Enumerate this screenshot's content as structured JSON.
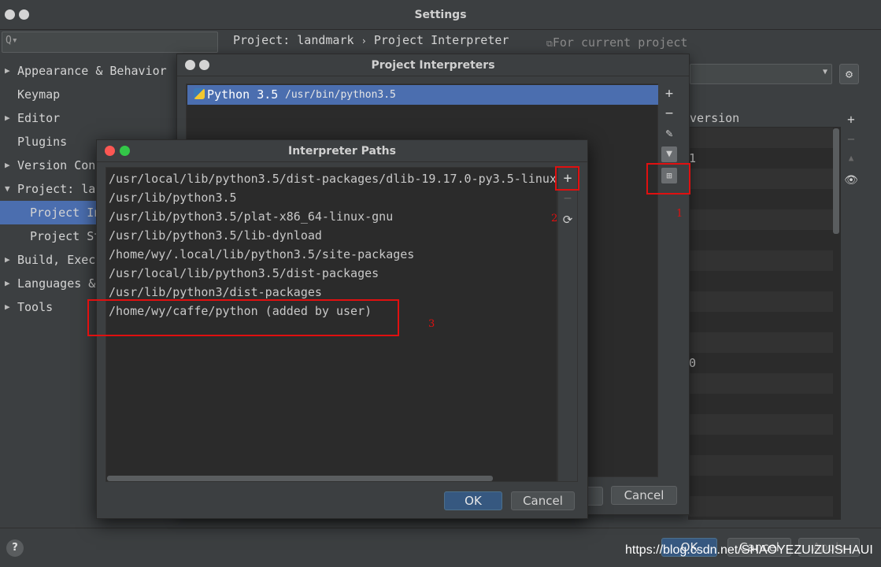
{
  "settings": {
    "title": "Settings",
    "search_placeholder": "Q▾",
    "breadcrumb": {
      "project": "Project: landmark",
      "separator": "›",
      "page": "Project Interpreter"
    },
    "for_current_project": "For current project",
    "pkg_header_version": "version",
    "pkg_visible_values": [
      "1",
      "0"
    ],
    "buttons": {
      "ok": "OK",
      "cancel": "Cancel",
      "apply": "Apply"
    },
    "help": "?"
  },
  "sidebar": {
    "items": [
      {
        "label": "Appearance & Behavior",
        "arrow": "▶"
      },
      {
        "label": "Keymap",
        "arrow": ""
      },
      {
        "label": "Editor",
        "arrow": "▶"
      },
      {
        "label": "Plugins",
        "arrow": ""
      },
      {
        "label": "Version Con",
        "arrow": "▶"
      },
      {
        "label": "Project: la",
        "arrow": "▼"
      },
      {
        "label": "Project In",
        "arrow": ""
      },
      {
        "label": "Project St",
        "arrow": ""
      },
      {
        "label": "Build, Exec",
        "arrow": "▶"
      },
      {
        "label": "Languages &",
        "arrow": "▶"
      },
      {
        "label": "Tools",
        "arrow": "▶"
      }
    ]
  },
  "project_interpreters": {
    "title": "Project Interpreters",
    "selected": {
      "name": "Python 3.5",
      "path": "/usr/bin/python3.5"
    },
    "cancel": "Cancel"
  },
  "interpreter_paths": {
    "title": "Interpreter Paths",
    "paths": [
      "/usr/local/lib/python3.5/dist-packages/dlib-19.17.0-py3.5-linux-",
      "/usr/lib/python3.5",
      "/usr/lib/python3.5/plat-x86_64-linux-gnu",
      "/usr/lib/python3.5/lib-dynload",
      "/home/wy/.local/lib/python3.5/site-packages",
      "/usr/local/lib/python3.5/dist-packages",
      "/usr/lib/python3/dist-packages",
      "/home/wy/caffe/python  (added by user)"
    ],
    "ok": "OK",
    "cancel": "Cancel"
  },
  "annotations": [
    "1",
    "2",
    "3"
  ],
  "watermark": "https://blog.csdn.net/SHAOYEZUIZUISHAUI",
  "colors": {
    "selection": "#4b6eaf",
    "annotation": "#e01010",
    "primary_button": "#365880"
  }
}
